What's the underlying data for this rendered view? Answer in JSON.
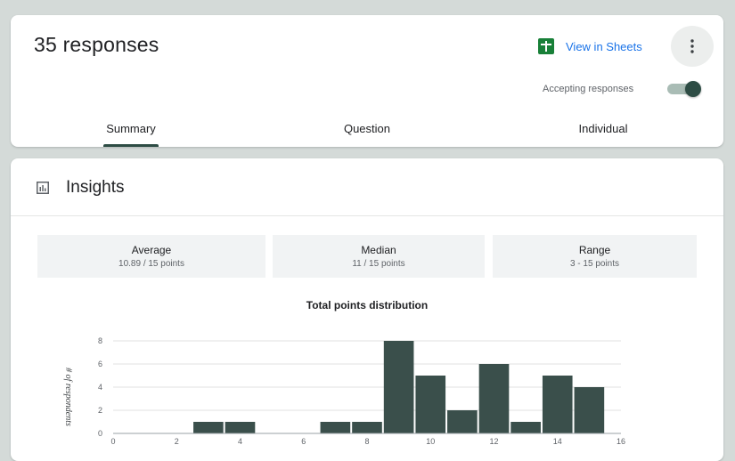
{
  "header": {
    "title": "35 responses",
    "sheets_label": "View in Sheets",
    "accepting_label": "Accepting responses",
    "accepting_on": true
  },
  "tabs": [
    {
      "label": "Summary",
      "active": true
    },
    {
      "label": "Question",
      "active": false
    },
    {
      "label": "Individual",
      "active": false
    }
  ],
  "insights": {
    "title": "Insights",
    "stats": [
      {
        "label": "Average",
        "value": "10.89 / 15 points"
      },
      {
        "label": "Median",
        "value": "11 / 15 points"
      },
      {
        "label": "Range",
        "value": "3 - 15 points"
      }
    ]
  },
  "colors": {
    "accent": "#2d4c44",
    "bar": "#3a4f4b",
    "link": "#1a73e8",
    "sheets_green": "#188038"
  },
  "chart_data": {
    "type": "bar",
    "title": "Total points distribution",
    "xlabel": "",
    "ylabel": "# of respondents",
    "x_ticks": [
      0,
      2,
      4,
      6,
      8,
      10,
      12,
      14,
      16
    ],
    "y_ticks": [
      0,
      2,
      4,
      6,
      8
    ],
    "xlim": [
      0,
      16
    ],
    "ylim": [
      0,
      8
    ],
    "categories": [
      3,
      4,
      5,
      6,
      7,
      8,
      9,
      10,
      11,
      12,
      13,
      14,
      15
    ],
    "values": [
      1,
      1,
      0,
      0,
      1,
      1,
      8,
      5,
      2,
      6,
      1,
      5,
      4
    ],
    "grid": true
  }
}
